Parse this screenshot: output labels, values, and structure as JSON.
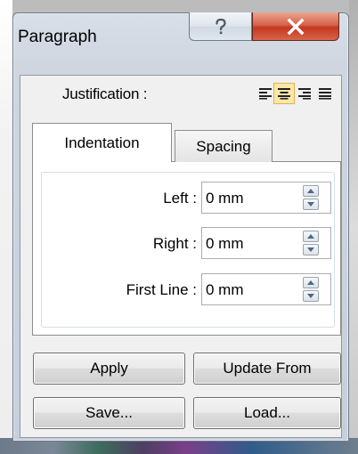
{
  "window": {
    "title": "Paragraph"
  },
  "titlebar": {
    "help_glyph": "?",
    "close_glyph": "X"
  },
  "justification": {
    "label": "Justification :",
    "options": [
      "align-left",
      "align-center",
      "align-right",
      "align-justify"
    ],
    "selected": "align-center"
  },
  "tabs": [
    {
      "label": "Indentation",
      "active": true
    },
    {
      "label": "Spacing",
      "active": false
    }
  ],
  "indentation": {
    "left": {
      "label": "Left :",
      "value": "0 mm"
    },
    "right": {
      "label": "Right :",
      "value": "0 mm"
    },
    "first_line": {
      "label": "First Line :",
      "value": "0 mm"
    }
  },
  "buttons": {
    "apply": "Apply",
    "update_from": "Update From",
    "save": "Save...",
    "load": "Load..."
  },
  "colors": {
    "close_red": "#c4381f",
    "selected_highlight": "#fbe7a7",
    "window_frame": "#cfd6e0"
  }
}
